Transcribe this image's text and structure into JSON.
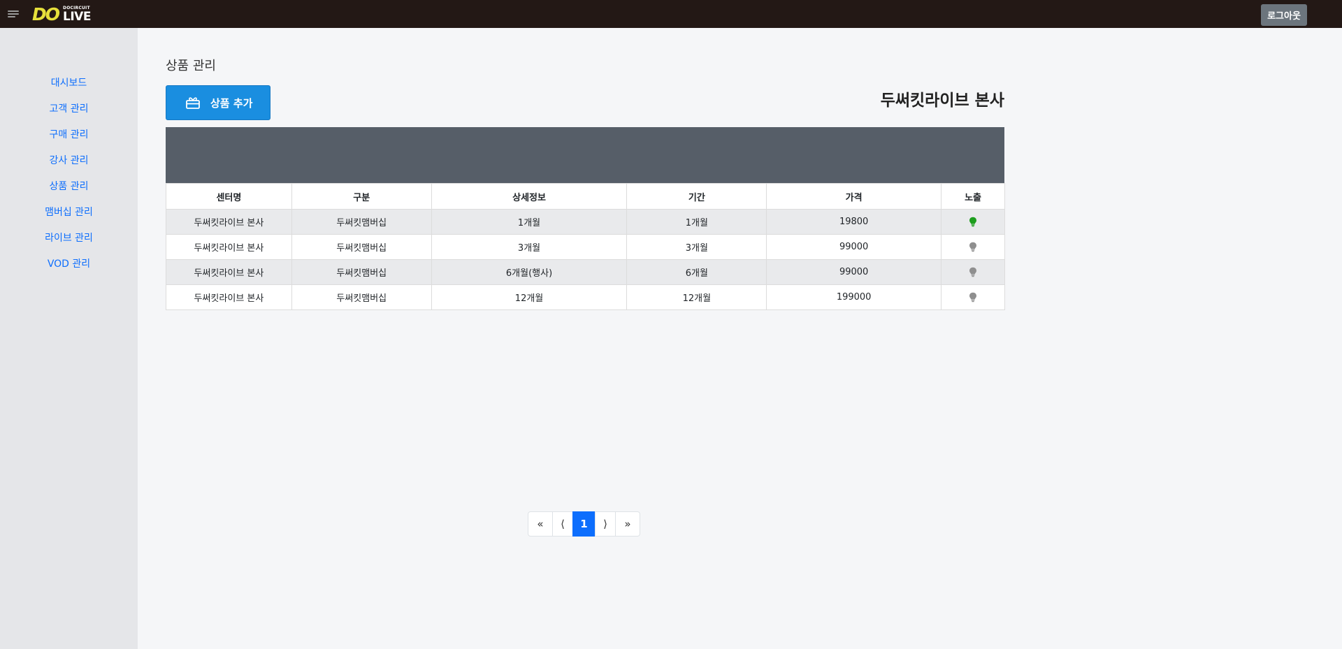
{
  "header": {
    "logo_mark": "DO",
    "logo_small": "DOCIRCUIT",
    "logo_live": "LIVE",
    "logout_label": "로그아웃"
  },
  "sidebar": {
    "items": [
      {
        "label": "대시보드"
      },
      {
        "label": "고객 관리"
      },
      {
        "label": "구매 관리"
      },
      {
        "label": "강사 관리"
      },
      {
        "label": "상품 관리"
      },
      {
        "label": "맴버십 관리"
      },
      {
        "label": "라이브 관리"
      },
      {
        "label": "VOD 관리"
      }
    ]
  },
  "main": {
    "page_title": "상품 관리",
    "add_button_label": "상품 추가",
    "center_name": "두써킷라이브 본사",
    "table": {
      "columns": [
        "센터명",
        "구분",
        "상세정보",
        "기간",
        "가격",
        "노출"
      ],
      "rows": [
        {
          "center": "두써킷라이브 본사",
          "category": "두써킷맴버십",
          "detail": "1개월",
          "period": "1개월",
          "price": "19800",
          "exposed": true
        },
        {
          "center": "두써킷라이브 본사",
          "category": "두써킷맴버십",
          "detail": "3개월",
          "period": "3개월",
          "price": "99000",
          "exposed": false
        },
        {
          "center": "두써킷라이브 본사",
          "category": "두써킷맴버십",
          "detail": "6개월(행사)",
          "period": "6개월",
          "price": "99000",
          "exposed": false
        },
        {
          "center": "두써킷라이브 본사",
          "category": "두써킷맴버십",
          "detail": "12개월",
          "period": "12개월",
          "price": "199000",
          "exposed": false
        }
      ]
    },
    "bulb_colors": {
      "on": "#1e9e1e",
      "off": "#8f8f8f"
    }
  },
  "pagination": {
    "first": "«",
    "prev": "⟨",
    "current": "1",
    "next": "⟩",
    "last": "»"
  }
}
